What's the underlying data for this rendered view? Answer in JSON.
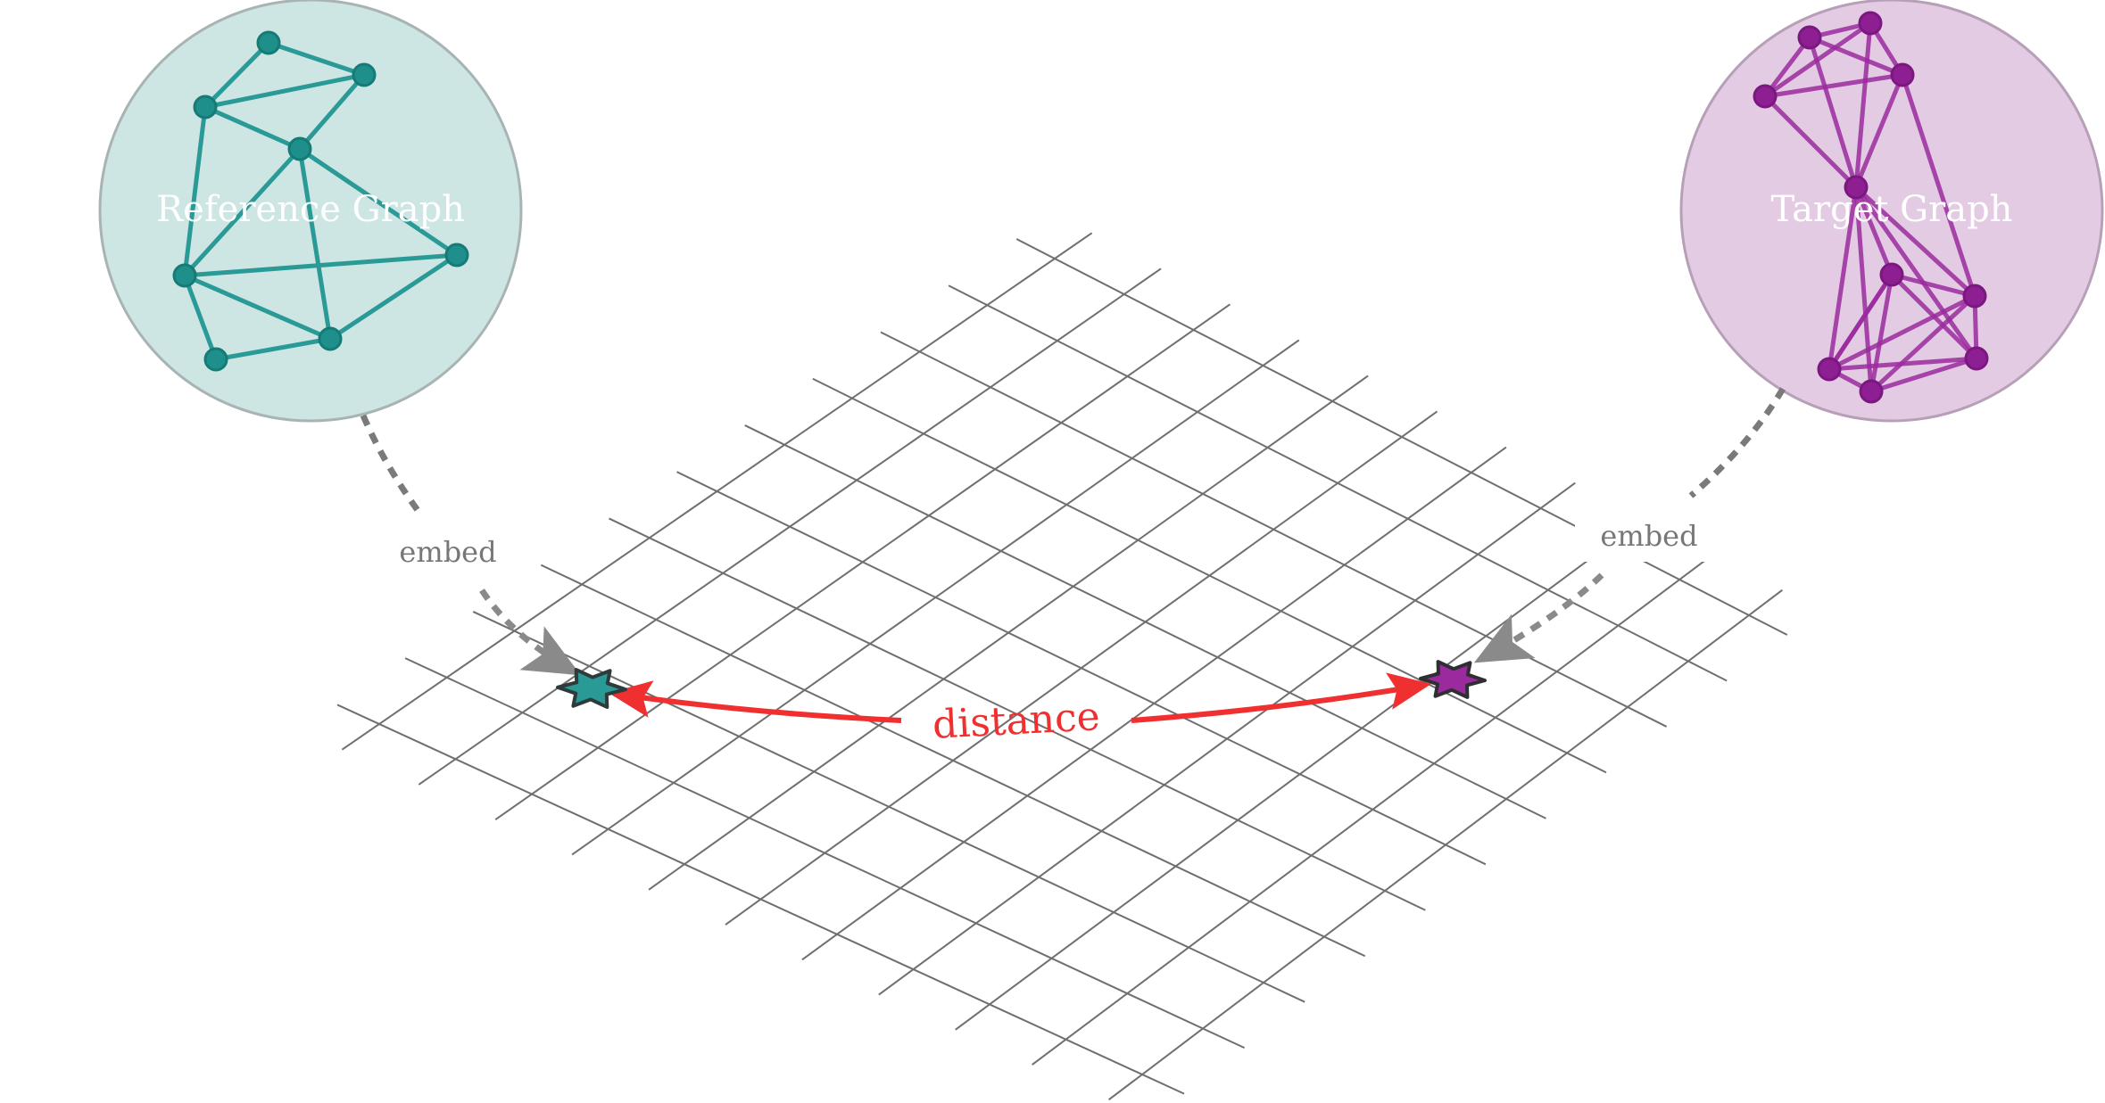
{
  "colors": {
    "reference": "#2a9a96",
    "reference_fill": "#cde6e4",
    "target": "#9a2a9e",
    "target_fill": "#e3cce3",
    "grid": "#6f6f6f",
    "embed_arrow": "#7a7a7a",
    "distance": "#f03030",
    "circle_border": "#a8b3b3"
  },
  "reference_graph": {
    "label": "Reference Graph",
    "nodes": 8,
    "edges": 13
  },
  "target_graph": {
    "label": "Target Graph",
    "nodes": 10,
    "edges": 27
  },
  "embed_left": {
    "label": "embed"
  },
  "embed_right": {
    "label": "embed"
  },
  "distance": {
    "label": "distance"
  },
  "grid": {
    "rows": 10,
    "cols": 10
  }
}
